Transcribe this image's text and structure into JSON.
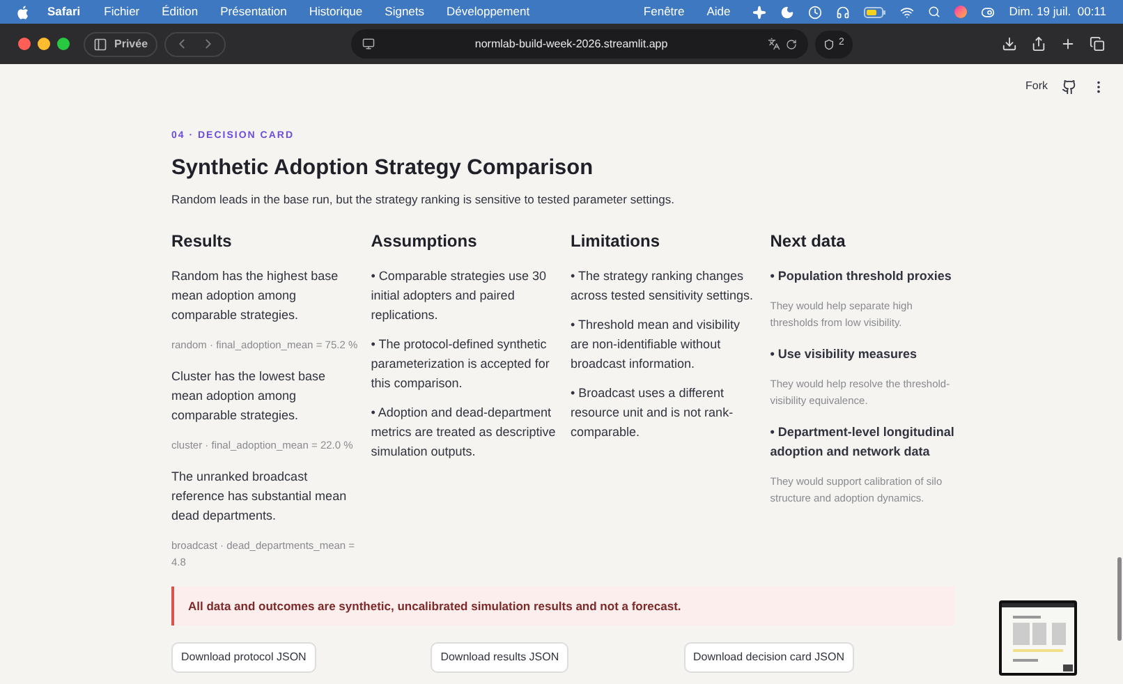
{
  "menubar": {
    "app": "Safari",
    "menus": [
      "Fichier",
      "Édition",
      "Présentation",
      "Historique",
      "Signets",
      "Développement"
    ],
    "right_menus": [
      "Fenêtre",
      "Aide"
    ],
    "clock": "Dim. 19 juil.  00:11"
  },
  "toolbar": {
    "private_label": "Privée",
    "url": "normlab-build-week-2026.streamlit.app",
    "shield_count": "2"
  },
  "header": {
    "fork": "Fork"
  },
  "card": {
    "eyebrow": "04 · DECISION CARD",
    "title": "Synthetic Adoption Strategy Comparison",
    "summary": "Random leads in the base run, but the strategy ranking is sensitive to tested parameter settings.",
    "sections": [
      {
        "title": "Results",
        "items": [
          {
            "kind": "text",
            "text": "Random has the highest base mean adoption among comparable strategies."
          },
          {
            "kind": "metric",
            "text": "random · final_adoption_mean = 75.2 %"
          },
          {
            "kind": "text",
            "text": "Cluster has the lowest base mean adoption among comparable strategies."
          },
          {
            "kind": "metric",
            "text": "cluster · final_adoption_mean = 22.0 %"
          },
          {
            "kind": "text",
            "text": "The unranked broadcast reference has substantial mean dead departments."
          },
          {
            "kind": "metric",
            "text": "broadcast · dead_departments_mean = 4.8"
          }
        ]
      },
      {
        "title": "Assumptions",
        "items": [
          {
            "kind": "text",
            "text": "• Comparable strategies use 30 initial adopters and paired replications."
          },
          {
            "kind": "text",
            "text": "• The protocol-defined synthetic parameterization is accepted for this comparison."
          },
          {
            "kind": "text",
            "text": "• Adoption and dead-department metrics are treated as descriptive simulation outputs."
          }
        ]
      },
      {
        "title": "Limitations",
        "items": [
          {
            "kind": "text",
            "text": "• The strategy ranking changes across tested sensitivity settings."
          },
          {
            "kind": "text",
            "text": "• Threshold mean and visibility are non-identifiable without broadcast information."
          },
          {
            "kind": "text",
            "text": "• Broadcast uses a different resource unit and is not rank-comparable."
          }
        ]
      },
      {
        "title": "Next data",
        "items": [
          {
            "kind": "heading",
            "text": "• Population threshold proxies"
          },
          {
            "kind": "note",
            "text": "They would help separate high thresholds from low visibility."
          },
          {
            "kind": "heading",
            "text": "• Use visibility measures"
          },
          {
            "kind": "note",
            "text": "They would help resolve the threshold-visibility equivalence."
          },
          {
            "kind": "heading",
            "text": "• Department-level longitudinal adoption and network data"
          },
          {
            "kind": "note",
            "text": "They would support calibration of silo structure and adoption dynamics."
          }
        ]
      }
    ]
  },
  "alert": {
    "text": "All data and outcomes are synthetic, uncalibrated simulation results and not a forecast."
  },
  "buttons": [
    "Download protocol JSON",
    "Download results JSON",
    "Download decision card JSON"
  ]
}
